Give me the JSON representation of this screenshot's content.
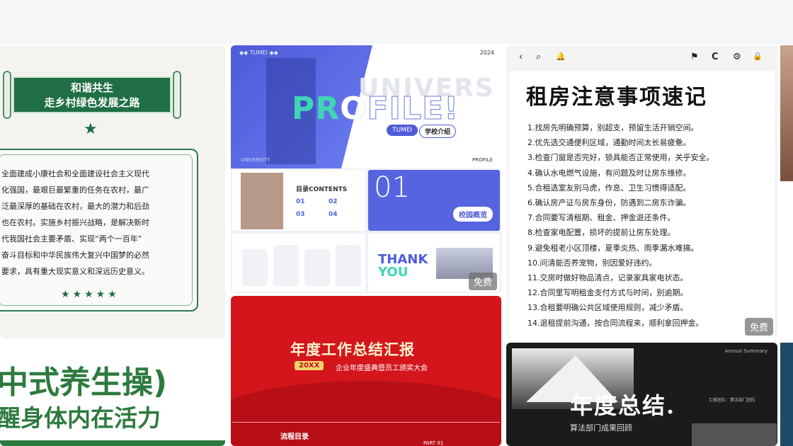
{
  "cards": [
    {
      "banner_line1": "和谐共生",
      "banner_line2": "走乡村绿色发展之路",
      "star": "★",
      "body_lines": [
        "全面建成小康社会和全面建设社会主义现代",
        "化强国，最艰巨最繁重的任务在农村，最广",
        "泛最深厚的基础在农村，最大的潜力和后劲",
        "也在农村。实施乡村振兴战略，是解决新时",
        "代我国社会主要矛盾、实现“两个一百年”",
        "奋斗目标和中华民族伟大复兴中国梦的必然",
        "要求，具有重大现实意义和深远历史意义。"
      ],
      "stars_row": "★★★★★"
    },
    {
      "tag": "◆◆ TUMEI ◆◆",
      "year": "2024",
      "bg_word": "UNIVERS",
      "title_part1": "PR",
      "title_part2": "O",
      "title_part3": "FILE!",
      "pill_tumei": "TUMEI",
      "pill_school": "学校介绍",
      "univ_small": "UNIVERSITY",
      "profile_small": "PROFILE",
      "toc_title": "目录CONTENTS",
      "toc_items": [
        "01",
        "02",
        "03",
        "04"
      ],
      "big_number": "01",
      "campus_pill": "校园概览",
      "thank": "THANK",
      "you": "YOU",
      "badge": "免费"
    },
    {
      "toolbar_icons": [
        "‹",
        "⌕",
        "🔔",
        "⚑",
        "C",
        "⚙",
        "🔒"
      ],
      "title": "租房注意事项速记",
      "items": [
        "1.找房先明确预算，别超支，预留生活开销空间。",
        "2.优先选交通便利区域，通勤时间太长易疲惫。",
        "3.检查门窗是否完好，锁具能否正常使用，关乎安全。",
        "4.确认水电燃气设施，有问题及时让房东维修。",
        "5.合租选室友别马虎，作息、卫生习惯得适配。",
        "6.确认房产证与房东身份，防遇到二房东诈骗。",
        "7.合同要写清租期、租金、押金退还条件。",
        "8.检查家电配置，损坏的提前让房东处理。",
        "9.避免租老小区顶楼，夏季炎热、雨季漏水难搞。",
        "10.问清能否养宠物，别因爱好违约。",
        "11.交房时做好物品清点，记录家具家电状态。",
        "12.合同里写明租金支付方式与时间，别逾期。",
        "13.合租要明确公共区域使用规则，减少矛盾。",
        "14.退租提前沟通，按合同流程来，顺利拿回押金。"
      ],
      "badge": "免费"
    },
    {
      "line1": "中式养生操)",
      "line2": "醒身体内在活力"
    },
    {
      "title": "年度工作总结汇报",
      "year": "20XX",
      "subtitle": "企业年度盛典暨员工颁奖大会",
      "flow": "流程目录",
      "part": "PART 01"
    },
    {
      "tag": "Annual Summary",
      "title": "年度总结.",
      "subtitle": "算法部门成果回顾",
      "note": "汇报团队：算法部门团队"
    }
  ],
  "colors": {
    "topbar": "#f5f6f8",
    "green": "#1f6e44",
    "profile_blue": "#4e5bd8",
    "profile_teal": "#3fd6b5",
    "report_red": "#d4151c",
    "dark": "#1b1b1b"
  }
}
